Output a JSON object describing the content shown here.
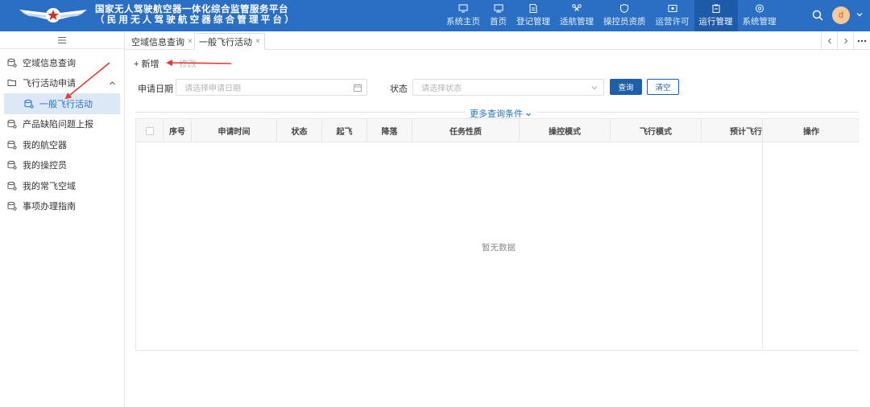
{
  "header": {
    "title_line1": "国家无人驾驶航空器一体化综合监管服务平台",
    "title_line2": "（民用无人驾驶航空器综合管理平台）",
    "nav": [
      {
        "label": "系统主页",
        "icon": "home-screen-icon"
      },
      {
        "label": "首页",
        "icon": "monitor-icon"
      },
      {
        "label": "登记管理",
        "icon": "document-icon"
      },
      {
        "label": "适航管理",
        "icon": "drone-icon"
      },
      {
        "label": "操控员资质",
        "icon": "shield-icon"
      },
      {
        "label": "运营许可",
        "icon": "license-icon"
      },
      {
        "label": "运行管理",
        "icon": "clipboard-icon"
      },
      {
        "label": "系统管理",
        "icon": "settings-icon"
      }
    ],
    "active_nav": "运行管理",
    "avatar_initial": "d"
  },
  "sidebar": {
    "items": [
      {
        "label": "空域信息查询"
      },
      {
        "label": "飞行活动申请"
      },
      {
        "label": "一般飞行活动"
      },
      {
        "label": "产品缺陷问题上报"
      },
      {
        "label": "我的航空器"
      },
      {
        "label": "我的操控员"
      },
      {
        "label": "我的常飞空域"
      },
      {
        "label": "事项办理指南"
      }
    ]
  },
  "tabs": [
    {
      "label": "空域信息查询",
      "close": "×"
    },
    {
      "label": "一般飞行活动",
      "close": "×"
    }
  ],
  "toolbar": {
    "add_label": "+ 新增",
    "edit_label": "修改"
  },
  "filters": {
    "date_label": "申请日期",
    "date_placeholder": "请选择申请日期",
    "status_label": "状态",
    "status_placeholder": "请选择状态",
    "query_label": "查询",
    "clear_label": "清空",
    "more_label": "更多查询条件"
  },
  "table": {
    "columns": [
      "序号",
      "申请时间",
      "状态",
      "起飞",
      "降落",
      "任务性质",
      "操控模式",
      "飞行模式",
      "预计飞行",
      "操作"
    ],
    "rows": [],
    "empty_text": "暂无数据"
  },
  "colors": {
    "header_bg": "#2a6fc4",
    "nav_active_bg": "#1d5aa8",
    "primary_button": "#1f5ea8",
    "annotation_arrow": "#e53935"
  }
}
